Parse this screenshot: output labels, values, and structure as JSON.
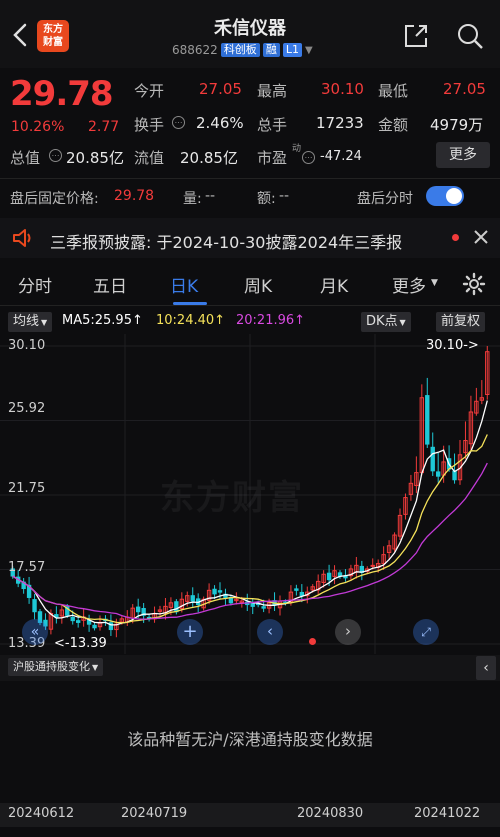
{
  "header": {
    "title": "禾信仪器",
    "code": "688622",
    "board_tag": "科创板",
    "margin_tag": "融",
    "level_tag": "L1",
    "logo_text_line1": "东方",
    "logo_text_line2": "财富"
  },
  "quote": {
    "price": "29.78",
    "change_pct": "10.26%",
    "change": "2.77",
    "open_label": "今开",
    "open": "27.05",
    "high_label": "最高",
    "high": "30.10",
    "low_label": "最低",
    "low": "27.05",
    "turnover_label": "换手",
    "turnover": "2.46%",
    "volume_label": "总手",
    "volume": "17233",
    "amount_label": "金额",
    "amount": "4979万",
    "mktcap_label": "总值",
    "mktcap": "20.85亿",
    "float_label": "流值",
    "float": "20.85亿",
    "pe_label": "市盈",
    "pe_sup": "动",
    "pe": "-47.24",
    "more_label": "更多"
  },
  "after_hours": {
    "price_label": "盘后固定价格:",
    "price": "29.78",
    "vol_label": "量:",
    "vol": "--",
    "amt_label": "额:",
    "amt": "--",
    "toggle_label": "盘后分时",
    "toggle_on": true
  },
  "notice": {
    "text": "三季报预披露:  于2024-10-30披露2024年三季报"
  },
  "tabs": [
    "分时",
    "五日",
    "日K",
    "周K",
    "月K",
    "更多"
  ],
  "active_tab": "日K",
  "ma_bar": {
    "indicator": "均线",
    "ma5": "MA5:25.95↑",
    "ma10": "10:24.40↑",
    "ma20": "20:21.96↑",
    "dk_label": "DK点",
    "adjust_label": "前复权"
  },
  "colors": {
    "up": "#f23b3b",
    "down": "#1ec9d6",
    "ma5": "#ffffff",
    "ma10": "#f5e25a",
    "ma20": "#c23ad6",
    "accent": "#3a7be8"
  },
  "chart_data": {
    "type": "candlestick",
    "y_ticks": [
      "30.10",
      "25.92",
      "21.75",
      "17.57",
      "13.39"
    ],
    "ylim": [
      13.39,
      30.1
    ],
    "max_label": "30.10->",
    "min_label": "<-13.39",
    "x_labels": [
      "20240612",
      "20240719",
      "20240830",
      "20241022"
    ],
    "watermark": "东方财富",
    "closes": [
      17.2,
      16.8,
      16.5,
      16.0,
      15.2,
      14.6,
      14.4,
      15.1,
      14.9,
      15.3,
      15.0,
      14.7,
      14.6,
      14.9,
      14.5,
      14.3,
      14.6,
      14.7,
      14.2,
      14.5,
      14.8,
      14.9,
      15.4,
      15.2,
      15.0,
      14.8,
      15.1,
      15.3,
      15.5,
      15.7,
      15.2,
      15.9,
      16.1,
      15.8,
      15.6,
      15.9,
      16.4,
      16.2,
      16.3,
      16.0,
      15.7,
      15.9,
      15.8,
      15.6,
      15.5,
      15.6,
      15.4,
      15.7,
      15.6,
      15.8,
      15.7,
      16.3,
      16.4,
      16.1,
      16.3,
      16.6,
      16.9,
      17.3,
      17.0,
      17.5,
      17.2,
      17.1,
      17.6,
      17.8,
      17.4,
      17.6,
      17.8,
      17.9,
      18.4,
      18.9,
      19.5,
      20.6,
      21.6,
      22.4,
      23.0,
      27.2,
      24.6,
      23.1,
      22.8,
      23.6,
      23.2,
      22.6,
      24.0,
      24.8,
      26.4,
      27.0,
      27.2,
      29.78
    ]
  },
  "hk_bar": {
    "label": "沪股通持股变化",
    "collapse_icon": "chevron-left-icon"
  },
  "hk_empty": "该品种暂无沪/深港通持股变化数据"
}
